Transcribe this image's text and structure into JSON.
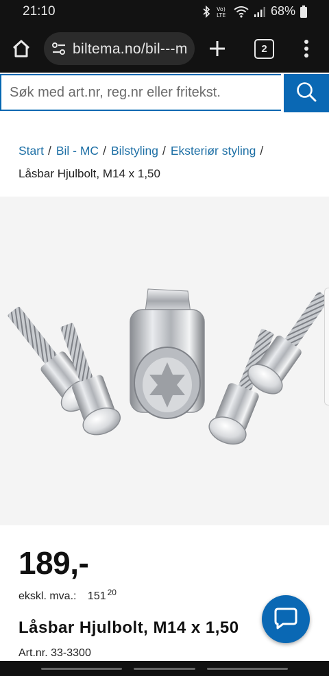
{
  "status_bar": {
    "time": "21:10",
    "battery": "68%",
    "network": "Vo) LTE"
  },
  "browser": {
    "url": "biltema.no/bil---m",
    "tab_count": "2"
  },
  "search": {
    "placeholder": "Søk med art.nr, reg.nr eller fritekst."
  },
  "breadcrumb": {
    "items": [
      "Start",
      "Bil - MC",
      "Bilstyling",
      "Eksteriør styling"
    ],
    "separator": "/",
    "current": "Låsbar Hjulbolt, M14 x 1,50"
  },
  "product": {
    "price": "189,-",
    "ex_vat_label": "ekskl. mva.:",
    "ex_vat_main": "151",
    "ex_vat_decimals": "20",
    "title": "Låsbar Hjulbolt, M14 x 1,50",
    "article_number": "Art.nr. 33-3300"
  },
  "colors": {
    "brand_blue": "#0a68b4",
    "link_blue": "#1d6fa5",
    "dark_chrome": "#121212"
  }
}
